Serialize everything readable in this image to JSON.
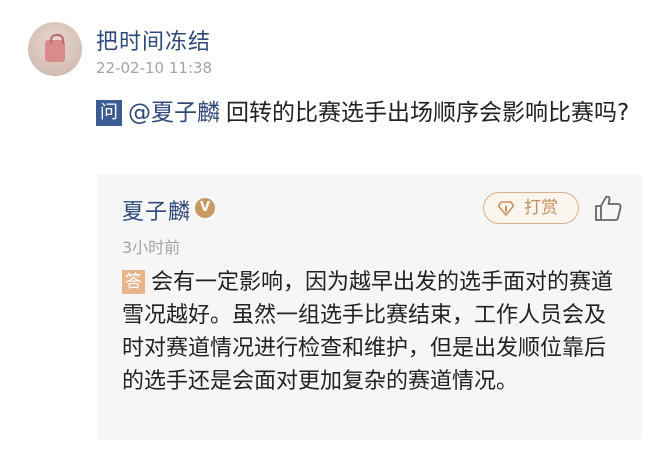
{
  "post": {
    "author_name": "把时间冻结",
    "timestamp": "22-02-10 11:38"
  },
  "question": {
    "badge": "问",
    "mention": "@夏子麟",
    "text": "回转的比赛选手出场顺序会影响比赛吗?"
  },
  "answer": {
    "author_name": "夏子麟",
    "verified_badge": "V",
    "time_ago": "3小时前",
    "reward_label": "打赏",
    "badge": "答",
    "text": "会有一定影响，因为越早出发的选手面对的赛道雪况越好。虽然一组选手比赛结束，工作人员会及时对赛道情况进行检查和维护，但是出发顺位靠后的选手还是会面对更加复杂的赛道情况。"
  },
  "icons": {
    "reward": "diamond-icon",
    "like": "thumbs-up-icon"
  },
  "colors": {
    "name_blue": "#2f4a7a",
    "question_badge": "#3b5b93",
    "answer_badge": "#e8b48a",
    "reward_accent": "#c9905a",
    "card_bg": "#f6f6f6",
    "muted_text": "#a3a3a3"
  }
}
